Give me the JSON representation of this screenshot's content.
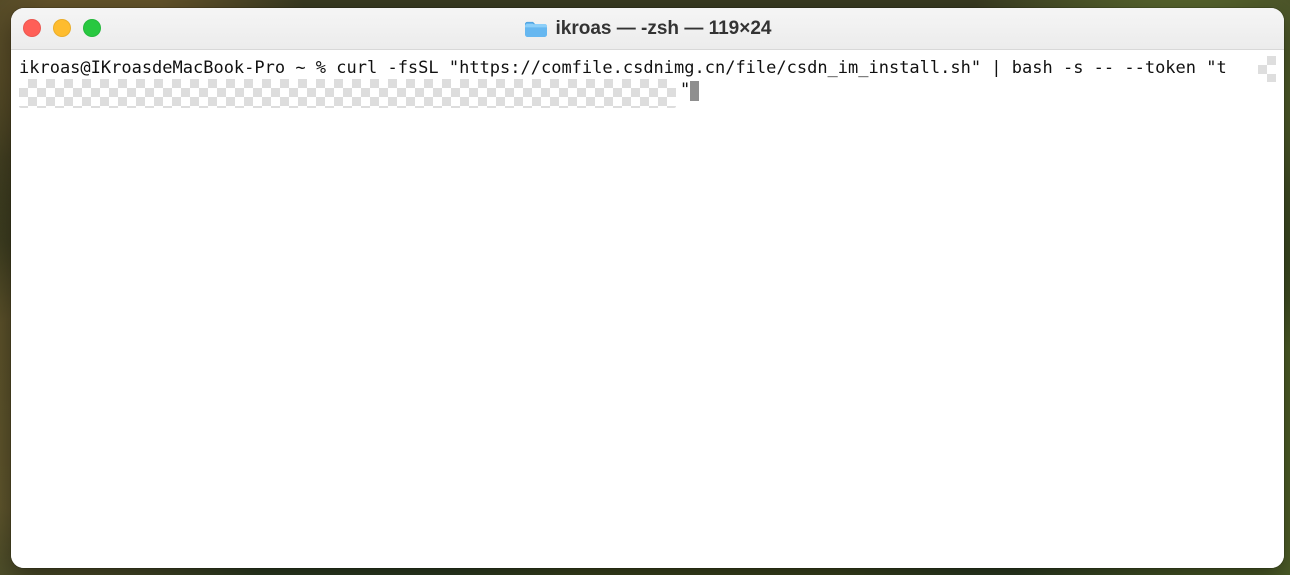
{
  "window": {
    "title": "ikroas — -zsh — 119×24"
  },
  "terminal": {
    "command_line": "ikroas@IKroasdeMacBook-Pro ~ % curl -fsSL \"https://comfile.csdnimg.cn/file/csdn_im_install.sh\" | bash -s -- --token \"t",
    "continued_end": "\""
  },
  "icons": {
    "folder": "folder-icon",
    "close": "close-icon",
    "minimize": "minimize-icon",
    "zoom": "zoom-icon"
  },
  "colors": {
    "close": "#ff5f57",
    "minimize": "#febc2e",
    "zoom": "#28c840",
    "titlebar": "#ececec",
    "terminal_bg": "#ffffff",
    "text": "#111111"
  }
}
